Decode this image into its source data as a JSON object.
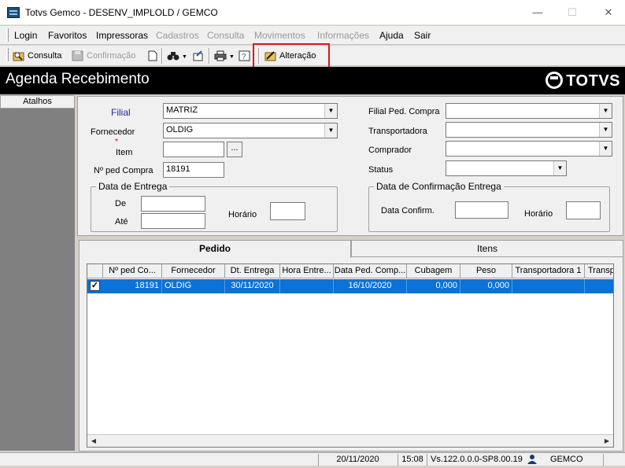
{
  "window": {
    "title": "Totvs Gemco - DESENV_IMPLOLD / GEMCO"
  },
  "menu": {
    "items": [
      {
        "label": "Login",
        "enabled": true
      },
      {
        "label": "Favoritos",
        "enabled": true
      },
      {
        "label": "Impressoras",
        "enabled": true
      },
      {
        "label": "Cadastros",
        "enabled": false
      },
      {
        "label": "Consulta",
        "enabled": false
      },
      {
        "label": "Movimentos",
        "enabled": false
      },
      {
        "label": "Informações",
        "enabled": false
      },
      {
        "label": "Ajuda",
        "enabled": true
      },
      {
        "label": "Sair",
        "enabled": true
      }
    ]
  },
  "toolbar": {
    "consulta": "Consulta",
    "confirmacao": "Confirmação",
    "alteracao": "Alteração"
  },
  "header": {
    "title": "Agenda Recebimento",
    "logo": "TOTVS"
  },
  "sidebar": {
    "title": "Atalhos"
  },
  "filters": {
    "filial_label": "Filial",
    "filial_value": "MATRIZ",
    "fornecedor_label": "Fornecedor",
    "fornecedor_value": "OLDIG",
    "item_label": "Item",
    "item_value": "",
    "item_button": "...",
    "nped_label": "Nº ped Compra",
    "nped_value": "18191",
    "data_entrega_group": "Data de Entrega",
    "de_label": "De",
    "ate_label": "Até",
    "horario_label": "Horário",
    "filial_ped_label": "Filial Ped. Compra",
    "transportadora_label": "Transportadora",
    "comprador_label": "Comprador",
    "status_label": "Status",
    "data_confirmacao_group": "Data de Confirmação Entrega",
    "data_confirm_label": "Data Confirm.",
    "horario2_label": "Horário"
  },
  "tabs": {
    "pedido": "Pedido",
    "itens": "Itens"
  },
  "grid": {
    "columns": [
      "Nº ped Co...",
      "Fornecedor",
      "Dt. Entrega",
      "Hora Entre...",
      "Data Ped. Comp...",
      "Cubagem",
      "Peso",
      "Transportadora 1",
      "Transp"
    ],
    "rows": [
      {
        "checked": true,
        "nped": "18191",
        "fornecedor": "OLDIG",
        "dt_entrega": "30/11/2020",
        "hora_entrega": "",
        "data_ped": "16/10/2020",
        "cubagem": "0,000",
        "peso": "0,000",
        "transportadora1": "",
        "transp": ""
      }
    ]
  },
  "status": {
    "date": "20/11/2020",
    "time": "15:08",
    "version": "Vs.122.0.0.0-SP8.00.19",
    "user": "GEMCO"
  }
}
